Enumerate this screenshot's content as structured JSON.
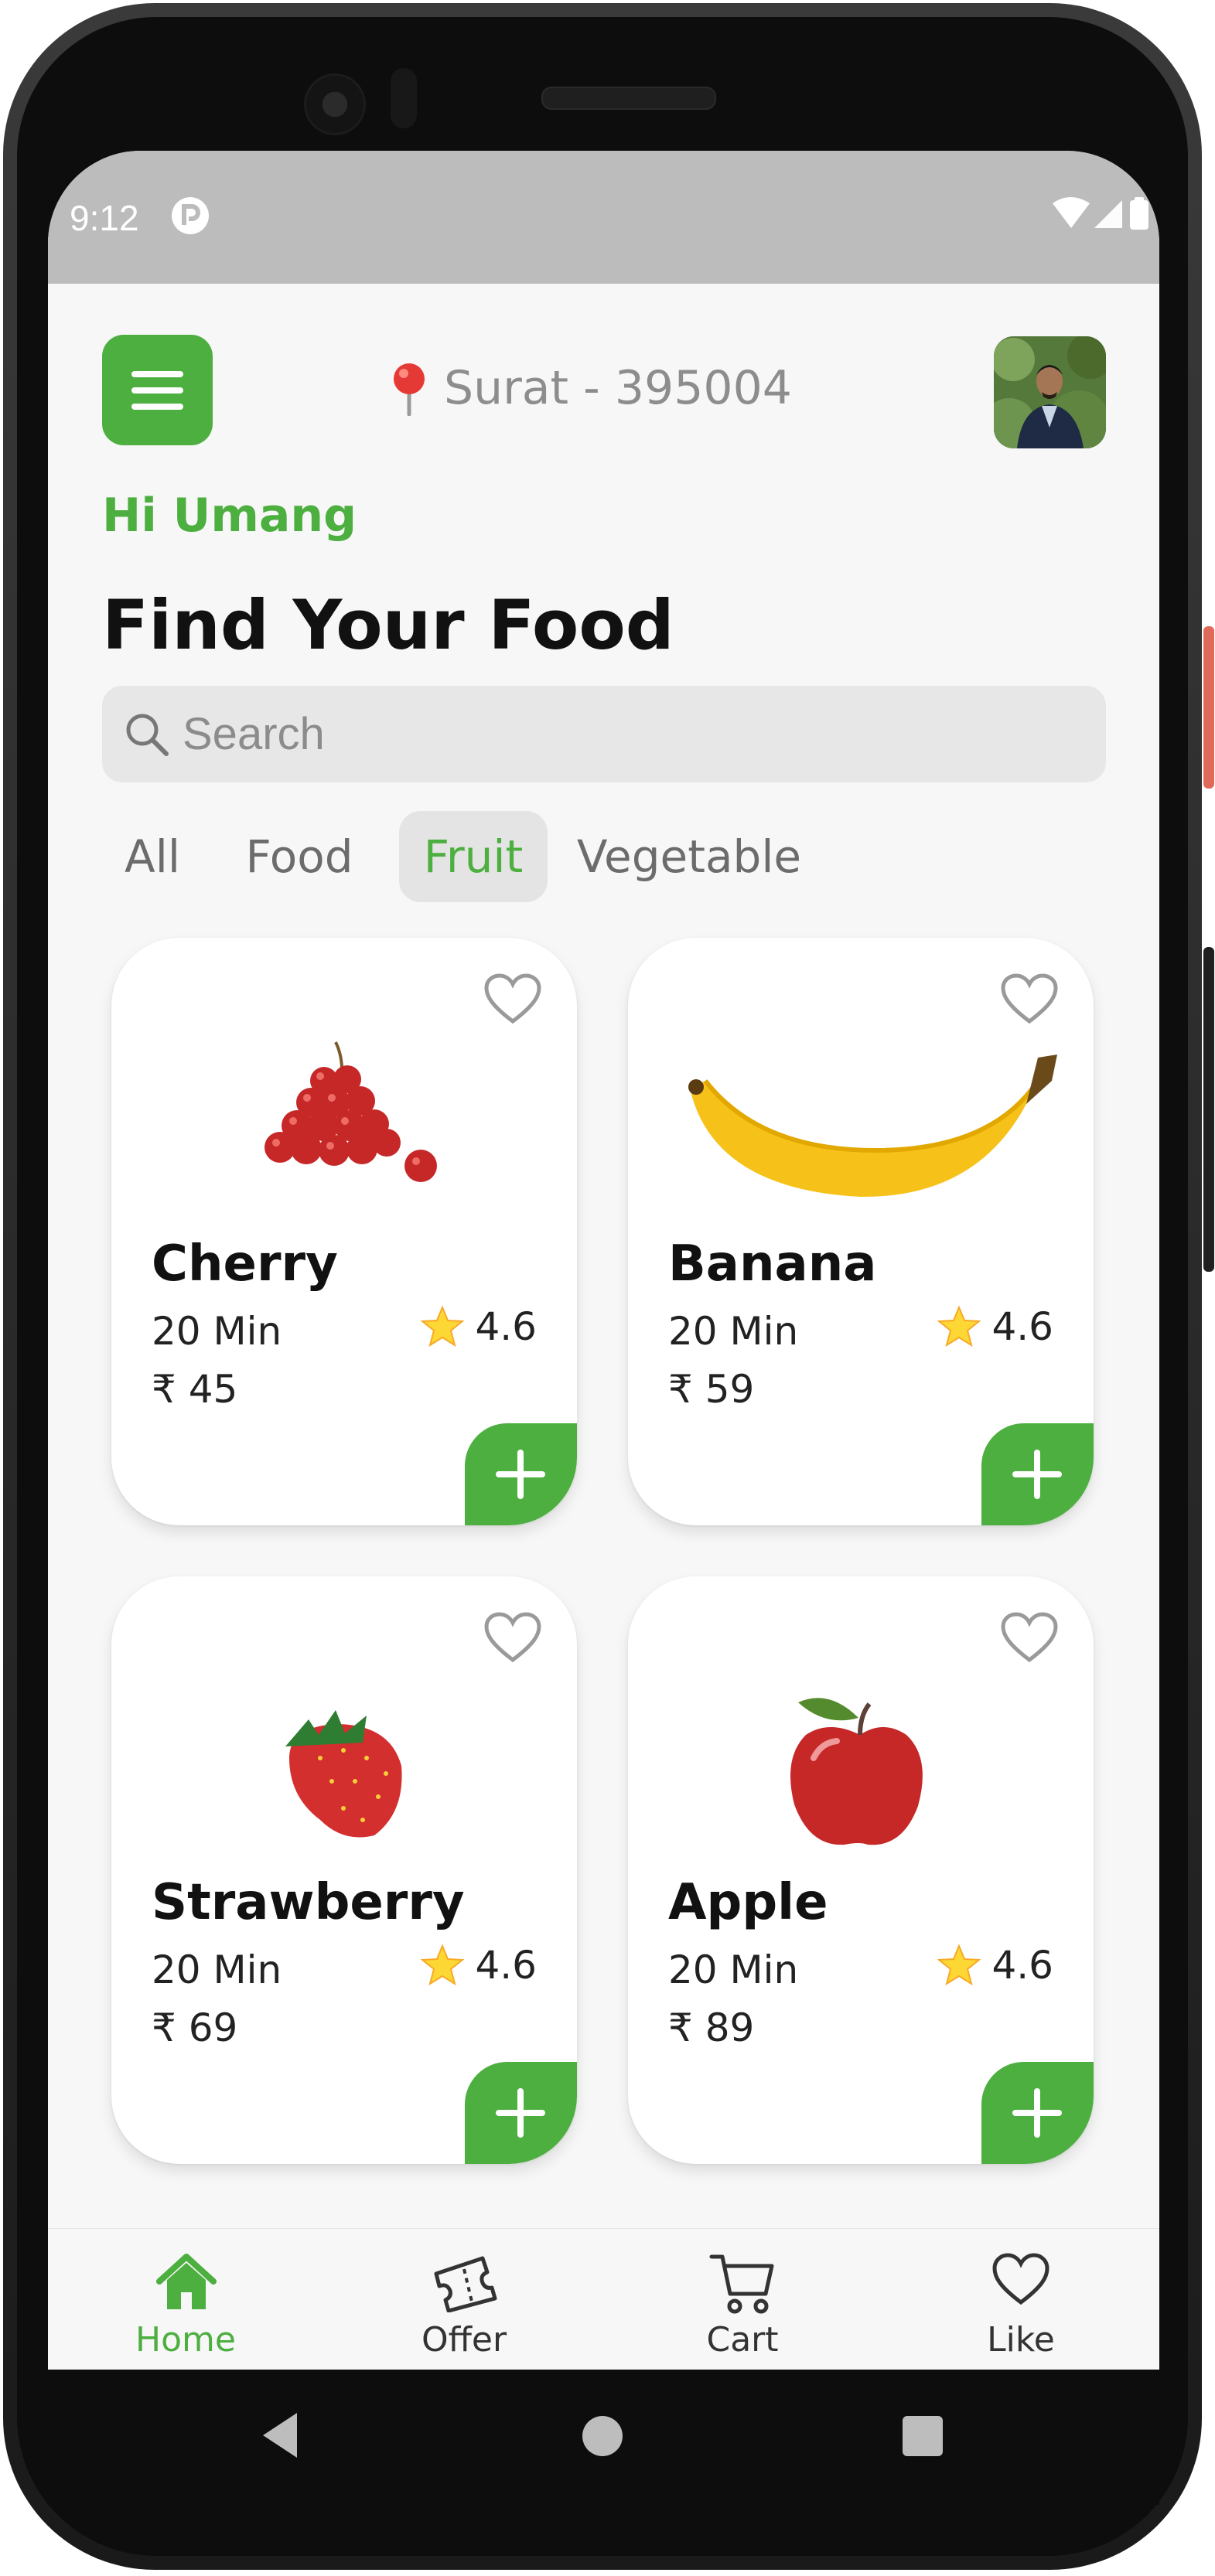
{
  "status_bar": {
    "time": "9:12"
  },
  "header": {
    "location_pin_icon": "pin-icon",
    "location": "Surat - 395004"
  },
  "greeting": "Hi Umang",
  "title": "Find Your Food",
  "search": {
    "placeholder": "Search",
    "value": ""
  },
  "categories": {
    "items": [
      "All",
      "Food",
      "Fruit",
      "Vegetable"
    ],
    "selected": "Fruit"
  },
  "products": [
    {
      "name": "Cherry",
      "time": "20 Min",
      "rating": "4.6",
      "price": "₹ 45"
    },
    {
      "name": "Banana",
      "time": "20 Min",
      "rating": "4.6",
      "price": "₹ 59"
    },
    {
      "name": "Strawberry",
      "time": "20 Min",
      "rating": "4.6",
      "price": "₹ 69"
    },
    {
      "name": "Apple",
      "time": "20 Min",
      "rating": "4.6",
      "price": "₹ 89"
    }
  ],
  "bottom_nav": {
    "items": [
      {
        "label": "Home",
        "icon": "home-icon",
        "active": true
      },
      {
        "label": "Offer",
        "icon": "ticket-icon",
        "active": false
      },
      {
        "label": "Cart",
        "icon": "cart-icon",
        "active": false
      },
      {
        "label": "Like",
        "icon": "heart-icon",
        "active": false
      }
    ]
  },
  "colors": {
    "accent": "#4caf3f",
    "background": "#f7f7f7",
    "card": "#ffffff",
    "muted_text": "#8d8d8d"
  }
}
